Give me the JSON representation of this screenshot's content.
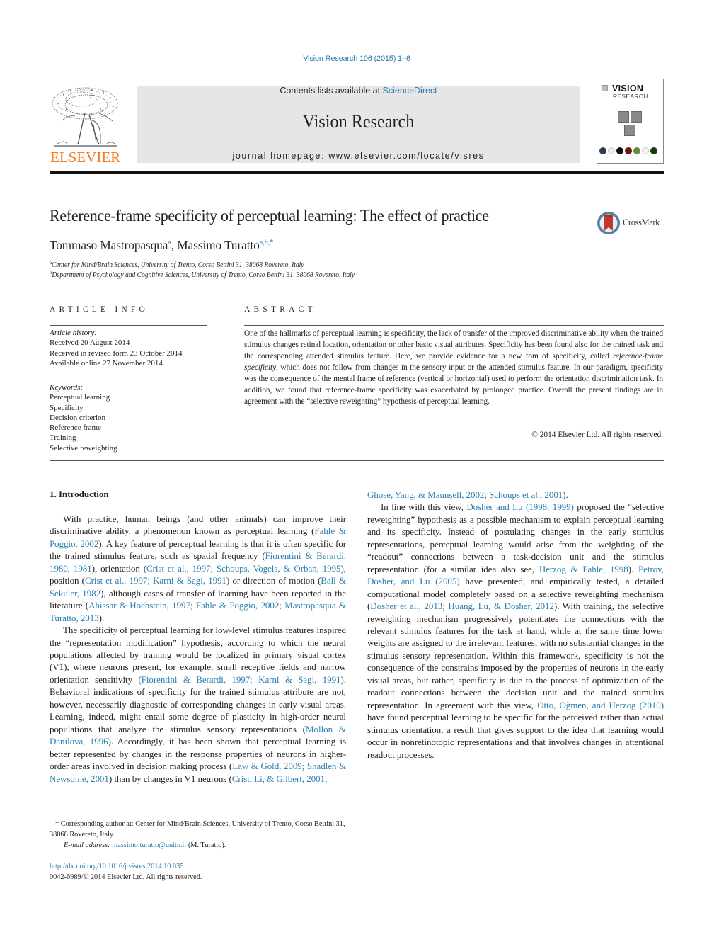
{
  "journal_citation": "Vision Research 106 (2015) 1–6",
  "masthead": {
    "contents_prefix": "Contents lists available at ",
    "contents_link": "ScienceDirect",
    "journal_title": "Vision Research",
    "homepage": "journal homepage: www.elsevier.com/locate/visres"
  },
  "publisher_logo": "ELSEVIER",
  "cover": {
    "title": "VISION",
    "subtitle": "RESEARCH"
  },
  "crossmark_label": "CrossMark",
  "article": {
    "title": "Reference-frame specificity of perceptual learning: The effect of practice",
    "authors": [
      {
        "name": "Tommaso Mastropasqua",
        "affil": "a"
      },
      {
        "name": "Massimo Turatto",
        "affil": "a,b,*"
      }
    ],
    "author_separator": ", ",
    "affiliations": [
      {
        "mark": "a",
        "text": "Center for Mind/Brain Sciences, University of Trento, Corso Bettini 31, 38068 Rovereto, Italy"
      },
      {
        "mark": "b",
        "text": "Department of Psychology and Cognitive Sciences, University of Trento, Corso Bettini 31, 38068 Rovereto, Italy"
      }
    ]
  },
  "article_info": {
    "heading": "ARTICLE INFO",
    "history_label": "Article history:",
    "history": [
      "Received 20 August 2014",
      "Received in revised form 23 October 2014",
      "Available online 27 November 2014"
    ],
    "keywords_label": "Keywords:",
    "keywords": [
      "Perceptual learning",
      "Specificity",
      "Decision criterion",
      "Reference frame",
      "Training",
      "Selective reweighting"
    ]
  },
  "abstract": {
    "heading": "ABSTRACT",
    "part1": "One of the hallmarks of perceptual learning is specificity, the lack of transfer of the improved discriminative ability when the trained stimulus changes retinal location, orientation or other basic visual attributes. Specificity has been found also for the trained task and the corresponding attended stimulus feature. Here, we provide evidence for a new fom of specificity, called ",
    "emphasis": "reference-frame specificity",
    "part2": ", which does not follow from changes in the sensory input or the attended stimulus feature. In our paradigm, specificity was the consequence of the mental frame of reference (vertical or horizontal) used to perform the orientation discrimination task. In addition, we found that reference-frame specificity was exacerbated by prolonged practice. Overall the present findings are in agreement with the “selective reweighting” hypothesis of perceptual learning.",
    "copyright": "© 2014 Elsevier Ltd. All rights reserved."
  },
  "introduction": {
    "heading": "1. Introduction",
    "p1": [
      {
        "t": "With practice, human beings (and other animals) can improve their discriminative ability, a phenomenon known as perceptual learning ("
      },
      {
        "l": "Fahle & Poggio, 2002"
      },
      {
        "t": "). A key feature of perceptual learning is that it is often specific for the trained stimulus feature, such as spatial frequency ("
      },
      {
        "l": "Fiorentini & Berardi, 1980, 1981"
      },
      {
        "t": "), orientation ("
      },
      {
        "l": "Crist et al., 1997; Schoups, Vogels, & Orban, 1995"
      },
      {
        "t": "), position ("
      },
      {
        "l": "Crist et al., 1997; Karni & Sagi, 1991"
      },
      {
        "t": ") or direction of motion ("
      },
      {
        "l": "Ball & Sekuler, 1982"
      },
      {
        "t": "), although cases of transfer of learning have been reported in the literature ("
      },
      {
        "l": "Ahissar & Hochstein, 1997; Fahle & Poggio, 2002; Mastropasqua & Turatto, 2013"
      },
      {
        "t": ")."
      }
    ],
    "p2": [
      {
        "t": "The specificity of perceptual learning for low-level stimulus features inspired the “representation modification” hypothesis, according to which the neural populations affected by training would be localized in primary visual cortex (V1), where neurons present, for example, small receptive fields and narrow orientation sensitivity ("
      },
      {
        "l": "Fiorentini & Berardi, 1997; Karni & Sagi, 1991"
      },
      {
        "t": "). Behavioral indications of specificity for the trained stimulus attribute are not, however, necessarily diagnostic of corresponding changes in early visual areas. Learning, indeed, might entail some degree of plasticity in high-order neural populations that analyze the stimulus sensory representations ("
      },
      {
        "l": "Mollon & Danilova, 1996"
      },
      {
        "t": "). Accordingly, it has been shown that perceptual learning is better represented by changes in the response properties of neurons in higher-order areas involved in decision making process ("
      },
      {
        "l": "Law & Gold, 2009; Shadlen & Newsome, 2001"
      },
      {
        "t": ") than by changes in V1 neurons ("
      },
      {
        "l": "Crist, Li, & Gilbert, 2001; Ghose, Yang, & Maunsell, 2002; Schoups et al., 2001"
      },
      {
        "t": ")."
      }
    ],
    "p3": [
      {
        "t": "In line with this view, "
      },
      {
        "l": "Dosher and Lu (1998, 1999)"
      },
      {
        "t": " proposed the “selective reweighting” hypothesis as a possible mechanism to explain perceptual learning and its specificity. Instead of postulating changes in the early stimulus representations, perceptual learning would arise from the weighting of the “readout” connections between a task-decision unit and the stimulus representation (for a similar idea also see, "
      },
      {
        "l": "Herzog & Fahle, 1998"
      },
      {
        "t": "). "
      },
      {
        "l": "Petrov, Dosher, and Lu (2005)"
      },
      {
        "t": " have presented, and empirically tested, a detailed computational model completely based on a selective reweighting mechanism ("
      },
      {
        "l": "Dosher et al., 2013; Huang, Lu, & Dosher, 2012"
      },
      {
        "t": "). With training, the selective reweighting mechanism progressively potentiates the connections with the relevant stimulus features for the task at hand, while at the same time lower weights are assigned to the irrelevant features, with no substantial changes in the stimulus sensory representation. Within this framework, specificity is not the consequence of the constrains imposed by the properties of neurons in the early visual areas, but rather, specificity is due to the process of optimization of the readout connections between the decision unit and the trained stimulus representation. In agreement with this view, "
      },
      {
        "l": "Otto, Oğmen, and Herzog (2010)"
      },
      {
        "t": " have found perceptual learning to be specific for the perceived rather than actual stimulus orientation, a result that gives support to the idea that learning would occur in nonretinotopic representations and that involves changes in attentional readout processes."
      }
    ]
  },
  "footnote": {
    "corresponding": "* Corresponding author at: Center for Mind/Brain Sciences, University of Trento, Corso Bettini 31, 38068 Rovereto, Italy.",
    "email_label": "E-mail address: ",
    "email": "massimo.turatto@unitn.it",
    "email_suffix": " (M. Turatto).",
    "doi": "http://dx.doi.org/10.1016/j.visres.2014.10.035",
    "issn": "0042-6989/© 2014 Elsevier Ltd. All rights reserved."
  },
  "colors": {
    "link": "#2a7fb0",
    "elsevier_orange": "#f47b20",
    "masthead_bg": "#e6e6e6",
    "crossmark_red": "#c0392b"
  }
}
